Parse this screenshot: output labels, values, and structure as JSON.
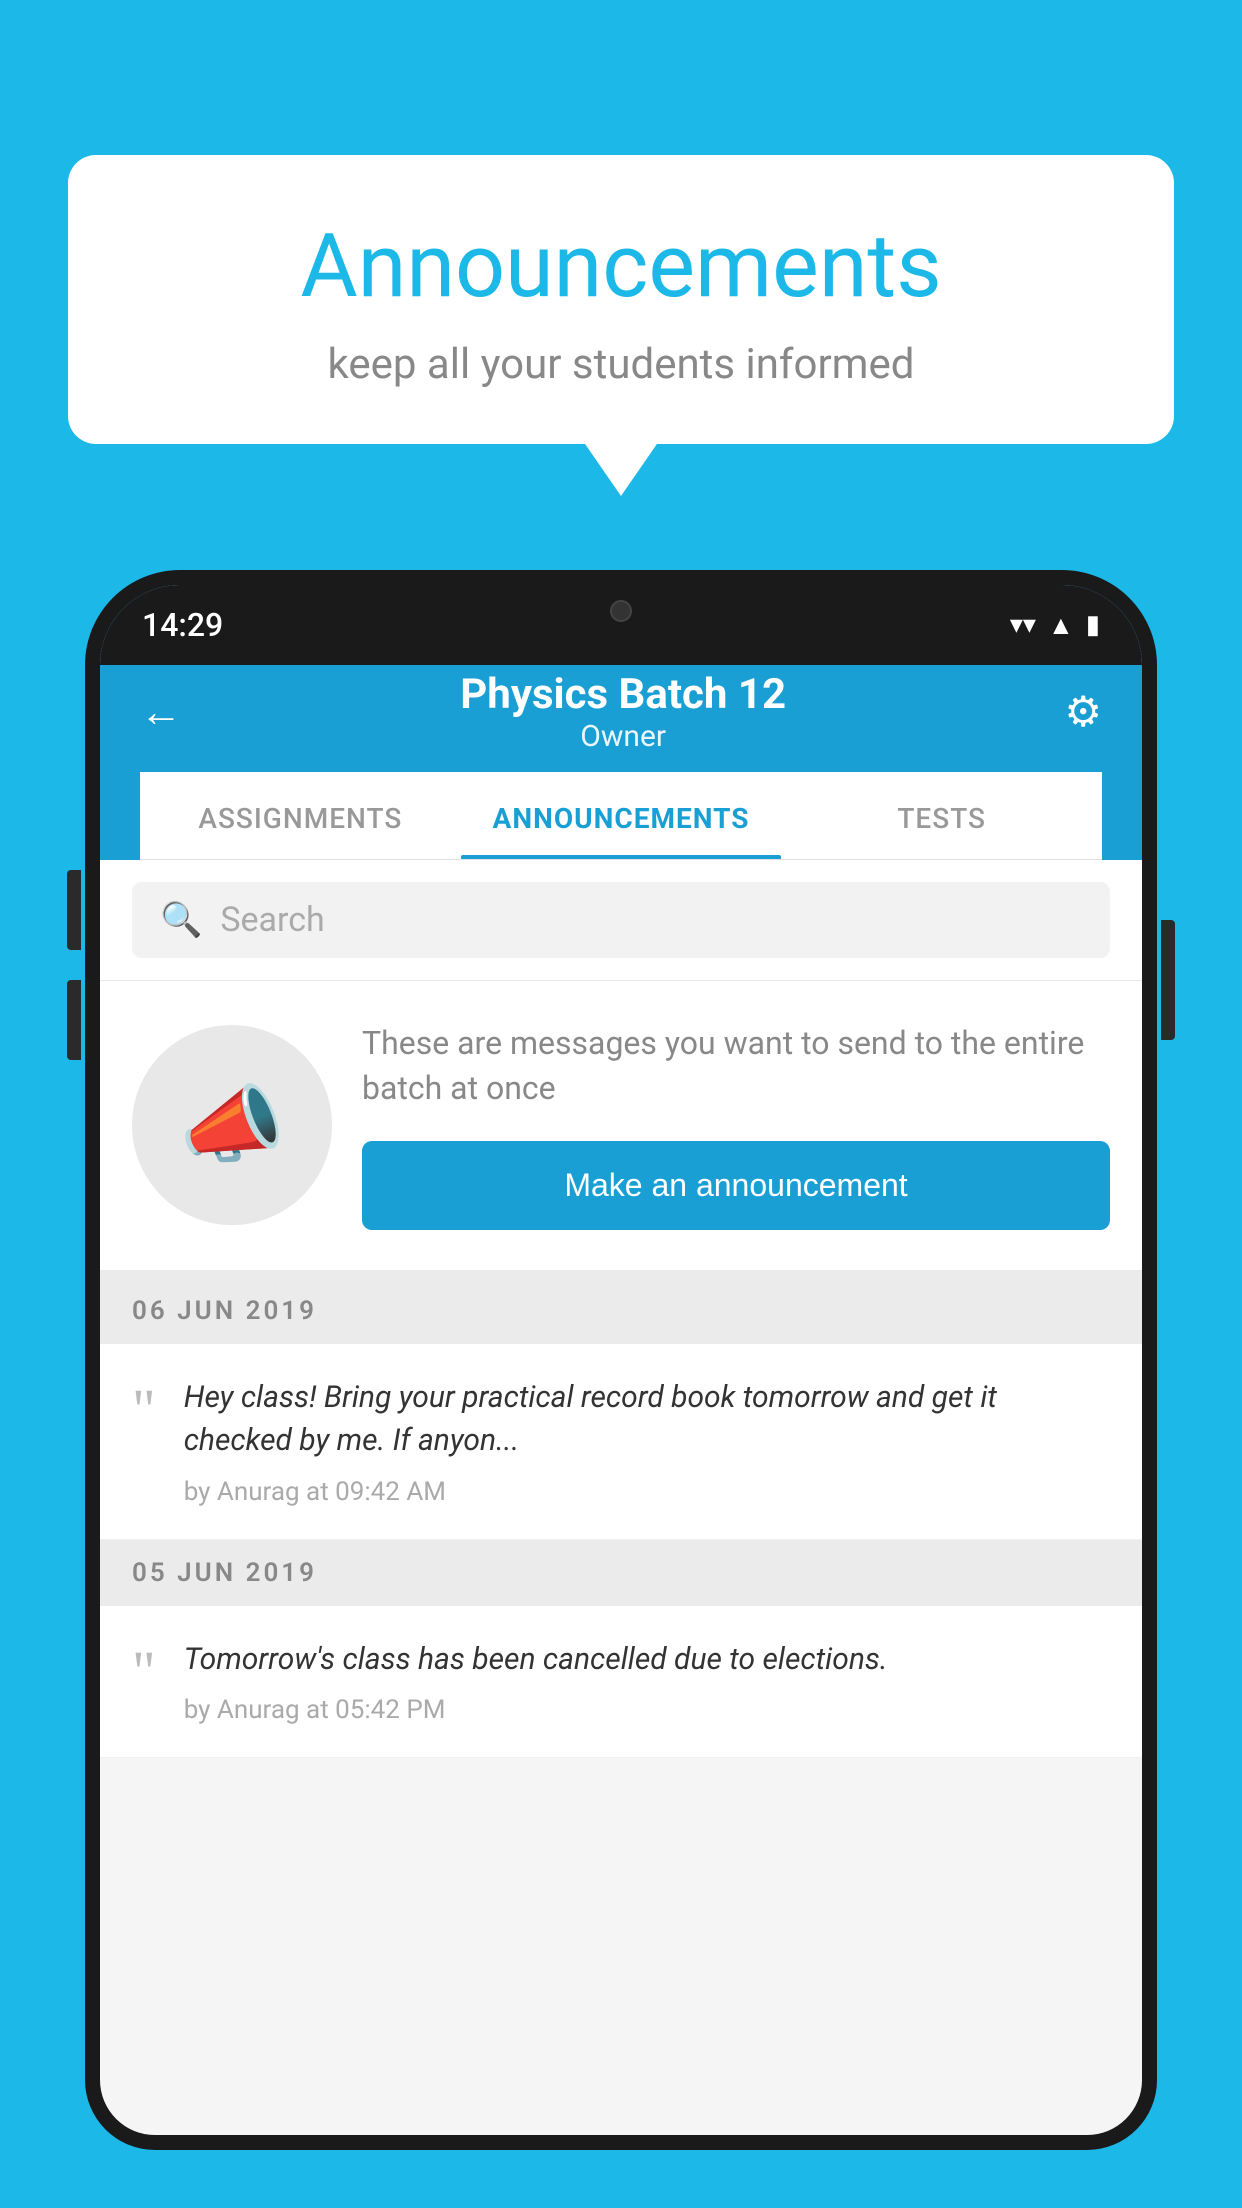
{
  "speechBubble": {
    "title": "Announcements",
    "subtitle": "keep all your students informed"
  },
  "statusBar": {
    "time": "14:29",
    "wifi": "▼",
    "signal": "▲",
    "battery": "▮"
  },
  "header": {
    "title": "Physics Batch 12",
    "subtitle": "Owner",
    "backLabel": "←",
    "gearLabel": "⚙"
  },
  "tabs": [
    {
      "id": "assignments",
      "label": "ASSIGNMENTS",
      "active": false
    },
    {
      "id": "announcements",
      "label": "ANNOUNCEMENTS",
      "active": true
    },
    {
      "id": "tests",
      "label": "TESTS",
      "active": false
    }
  ],
  "search": {
    "placeholder": "Search"
  },
  "promo": {
    "description": "These are messages you want to send to the entire batch at once",
    "buttonLabel": "Make an announcement"
  },
  "announcements": [
    {
      "date": "06  JUN  2019",
      "text": "Hey class! Bring your practical record book tomorrow and get it checked by me. If anyon...",
      "meta": "by Anurag at 09:42 AM"
    },
    {
      "date": "05  JUN  2019",
      "text": "Tomorrow's class has been cancelled due to elections.",
      "meta": "by Anurag at 05:42 PM"
    }
  ],
  "colors": {
    "brand": "#1bb8e8",
    "headerBlue": "#1a9fd4",
    "buttonBlue": "#1a9fd4"
  }
}
